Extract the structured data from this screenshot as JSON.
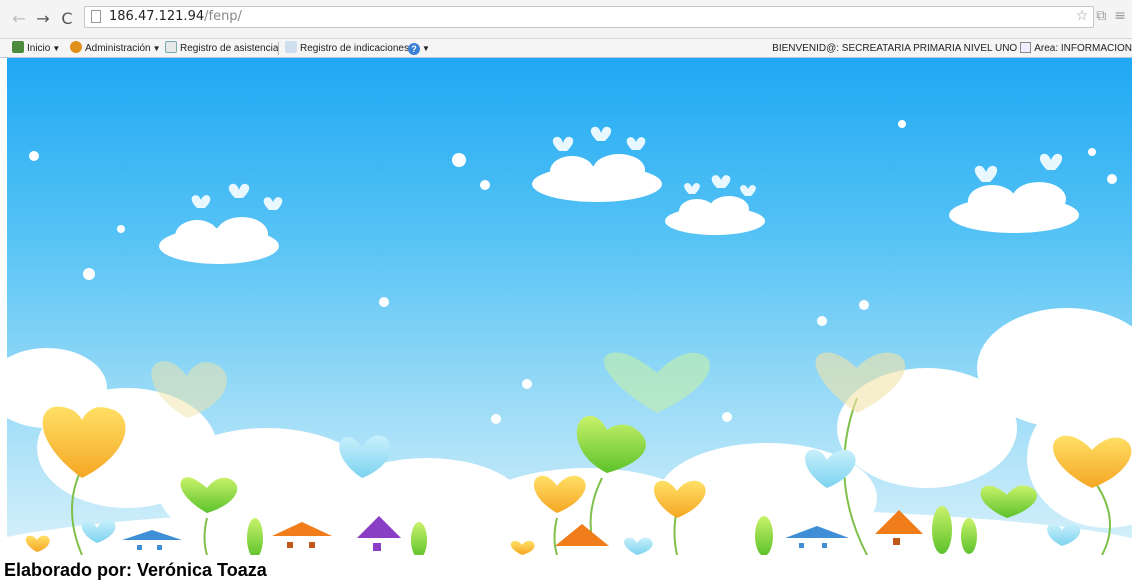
{
  "browser": {
    "url_host": "186.47.121.94",
    "url_path": "/fenp/",
    "back_icon": "back-arrow-icon",
    "forward_icon": "forward-arrow-icon",
    "reload_icon": "reload-icon",
    "star_icon": "star-icon",
    "menu_icon": "menu-icon"
  },
  "toolbar": {
    "items": [
      {
        "label": "Inicio",
        "icon": "home-icon",
        "dropdown": true
      },
      {
        "label": "Administración",
        "icon": "users-icon",
        "dropdown": true
      },
      {
        "label": "Registro de asistencia",
        "icon": "edit-icon",
        "dropdown": false
      },
      {
        "label": "Registro de indicaciones",
        "icon": "notes-icon",
        "dropdown": false
      }
    ],
    "help_icon": "help-icon",
    "welcome_text": "BIENVENID@: SECREATARIA PRIMARIA NIVEL UNO",
    "area_text": "Area: INFORMACION"
  },
  "banner": {
    "description_icon": "decorative-banner",
    "colors": {
      "sky_top": "#1fa8f3",
      "sky_bottom": "#d9f1fb"
    }
  },
  "footer": {
    "caption": "Elaborado por: Verónica Toaza"
  }
}
